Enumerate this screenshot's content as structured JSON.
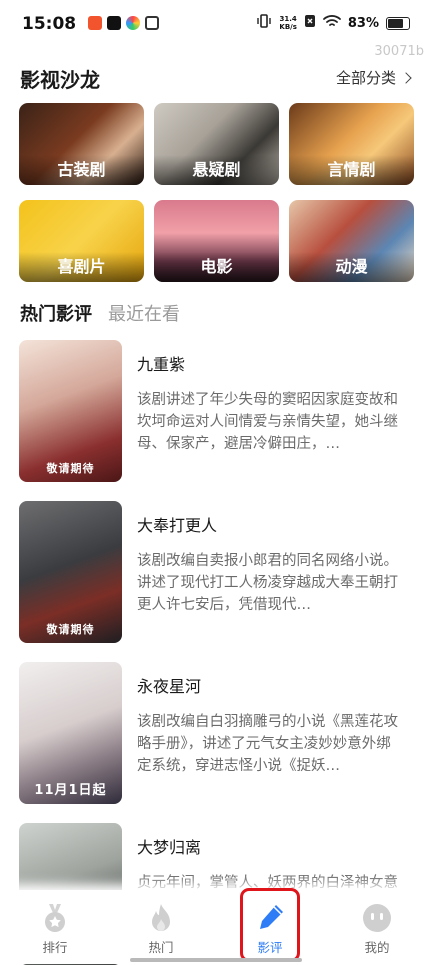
{
  "status_bar": {
    "time": "15:08",
    "net_speed_value": "31.4",
    "net_speed_unit": "KB/s",
    "battery": "83%"
  },
  "watermark": "30071b",
  "salon": {
    "title": "影视沙龙",
    "all_categories": "全部分类",
    "genres": [
      "古装剧",
      "悬疑剧",
      "言情剧",
      "喜剧片",
      "电影",
      "动漫"
    ]
  },
  "tabs": {
    "active": "热门影评",
    "inactive": "最近在看"
  },
  "reviews": [
    {
      "title": "九重紫",
      "poster_tag": "敬请期待",
      "desc": "该剧讲述了年少失母的窦昭因家庭变故和坎坷命运对人间情爱与亲情失望，她斗继母、保家产，避居冷僻田庄，…"
    },
    {
      "title": "大奉打更人",
      "poster_tag": "敬请期待",
      "desc": "该剧改编自卖报小郎君的同名网络小说。讲述了现代打工人杨凌穿越成大奉王朝打更人许七安后，凭借现代…"
    },
    {
      "title": "永夜星河",
      "poster_tag": "11月1日起",
      "desc": "该剧改编自白羽摘雕弓的小说《黑莲花攻略手册》，讲述了元气女主凌妙妙意外绑定系统，穿进志怪小说《捉妖…"
    },
    {
      "title": "大梦归离",
      "poster_tag": "",
      "desc": "贞元年间，掌管人、妖两界的白泽神女意外身亡，白泽令失踪，妖兽在人"
    }
  ],
  "bottom_nav": [
    {
      "label": "排行",
      "icon": "medal-icon"
    },
    {
      "label": "热门",
      "icon": "flame-icon"
    },
    {
      "label": "影评",
      "icon": "pen-icon"
    },
    {
      "label": "我的",
      "icon": "face-icon"
    }
  ],
  "colors": {
    "accent": "#2e7cf6",
    "highlight": "#e0141b",
    "inactive_icon": "#cfcfcf"
  }
}
